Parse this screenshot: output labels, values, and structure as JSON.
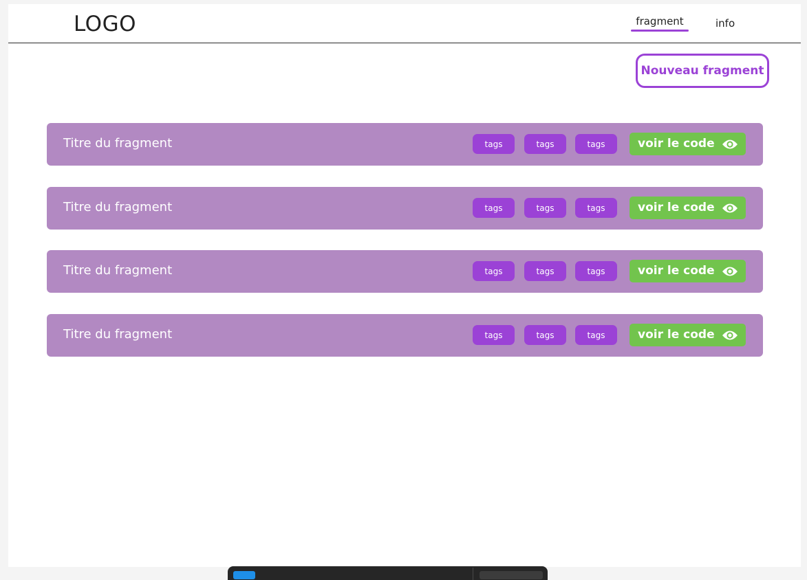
{
  "header": {
    "logo": "LOGO",
    "nav": [
      {
        "label": "fragment",
        "active": true
      },
      {
        "label": "info",
        "active": false
      }
    ]
  },
  "actions": {
    "new_fragment_label": "Nouveau fragment"
  },
  "fragments": [
    {
      "title": "Titre du fragment",
      "tags": [
        "tags",
        "tags",
        "tags"
      ],
      "action_label": "voir le code"
    },
    {
      "title": "Titre du fragment",
      "tags": [
        "tags",
        "tags",
        "tags"
      ],
      "action_label": "voir le code"
    },
    {
      "title": "Titre du fragment",
      "tags": [
        "tags",
        "tags",
        "tags"
      ],
      "action_label": "voir le code"
    },
    {
      "title": "Titre du fragment",
      "tags": [
        "tags",
        "tags",
        "tags"
      ],
      "action_label": "voir le code"
    }
  ],
  "icons": {
    "view": "eye-icon"
  },
  "colors": {
    "accent": "#9b42d6",
    "row_background": "#b289c2",
    "action_button": "#72c44d"
  }
}
